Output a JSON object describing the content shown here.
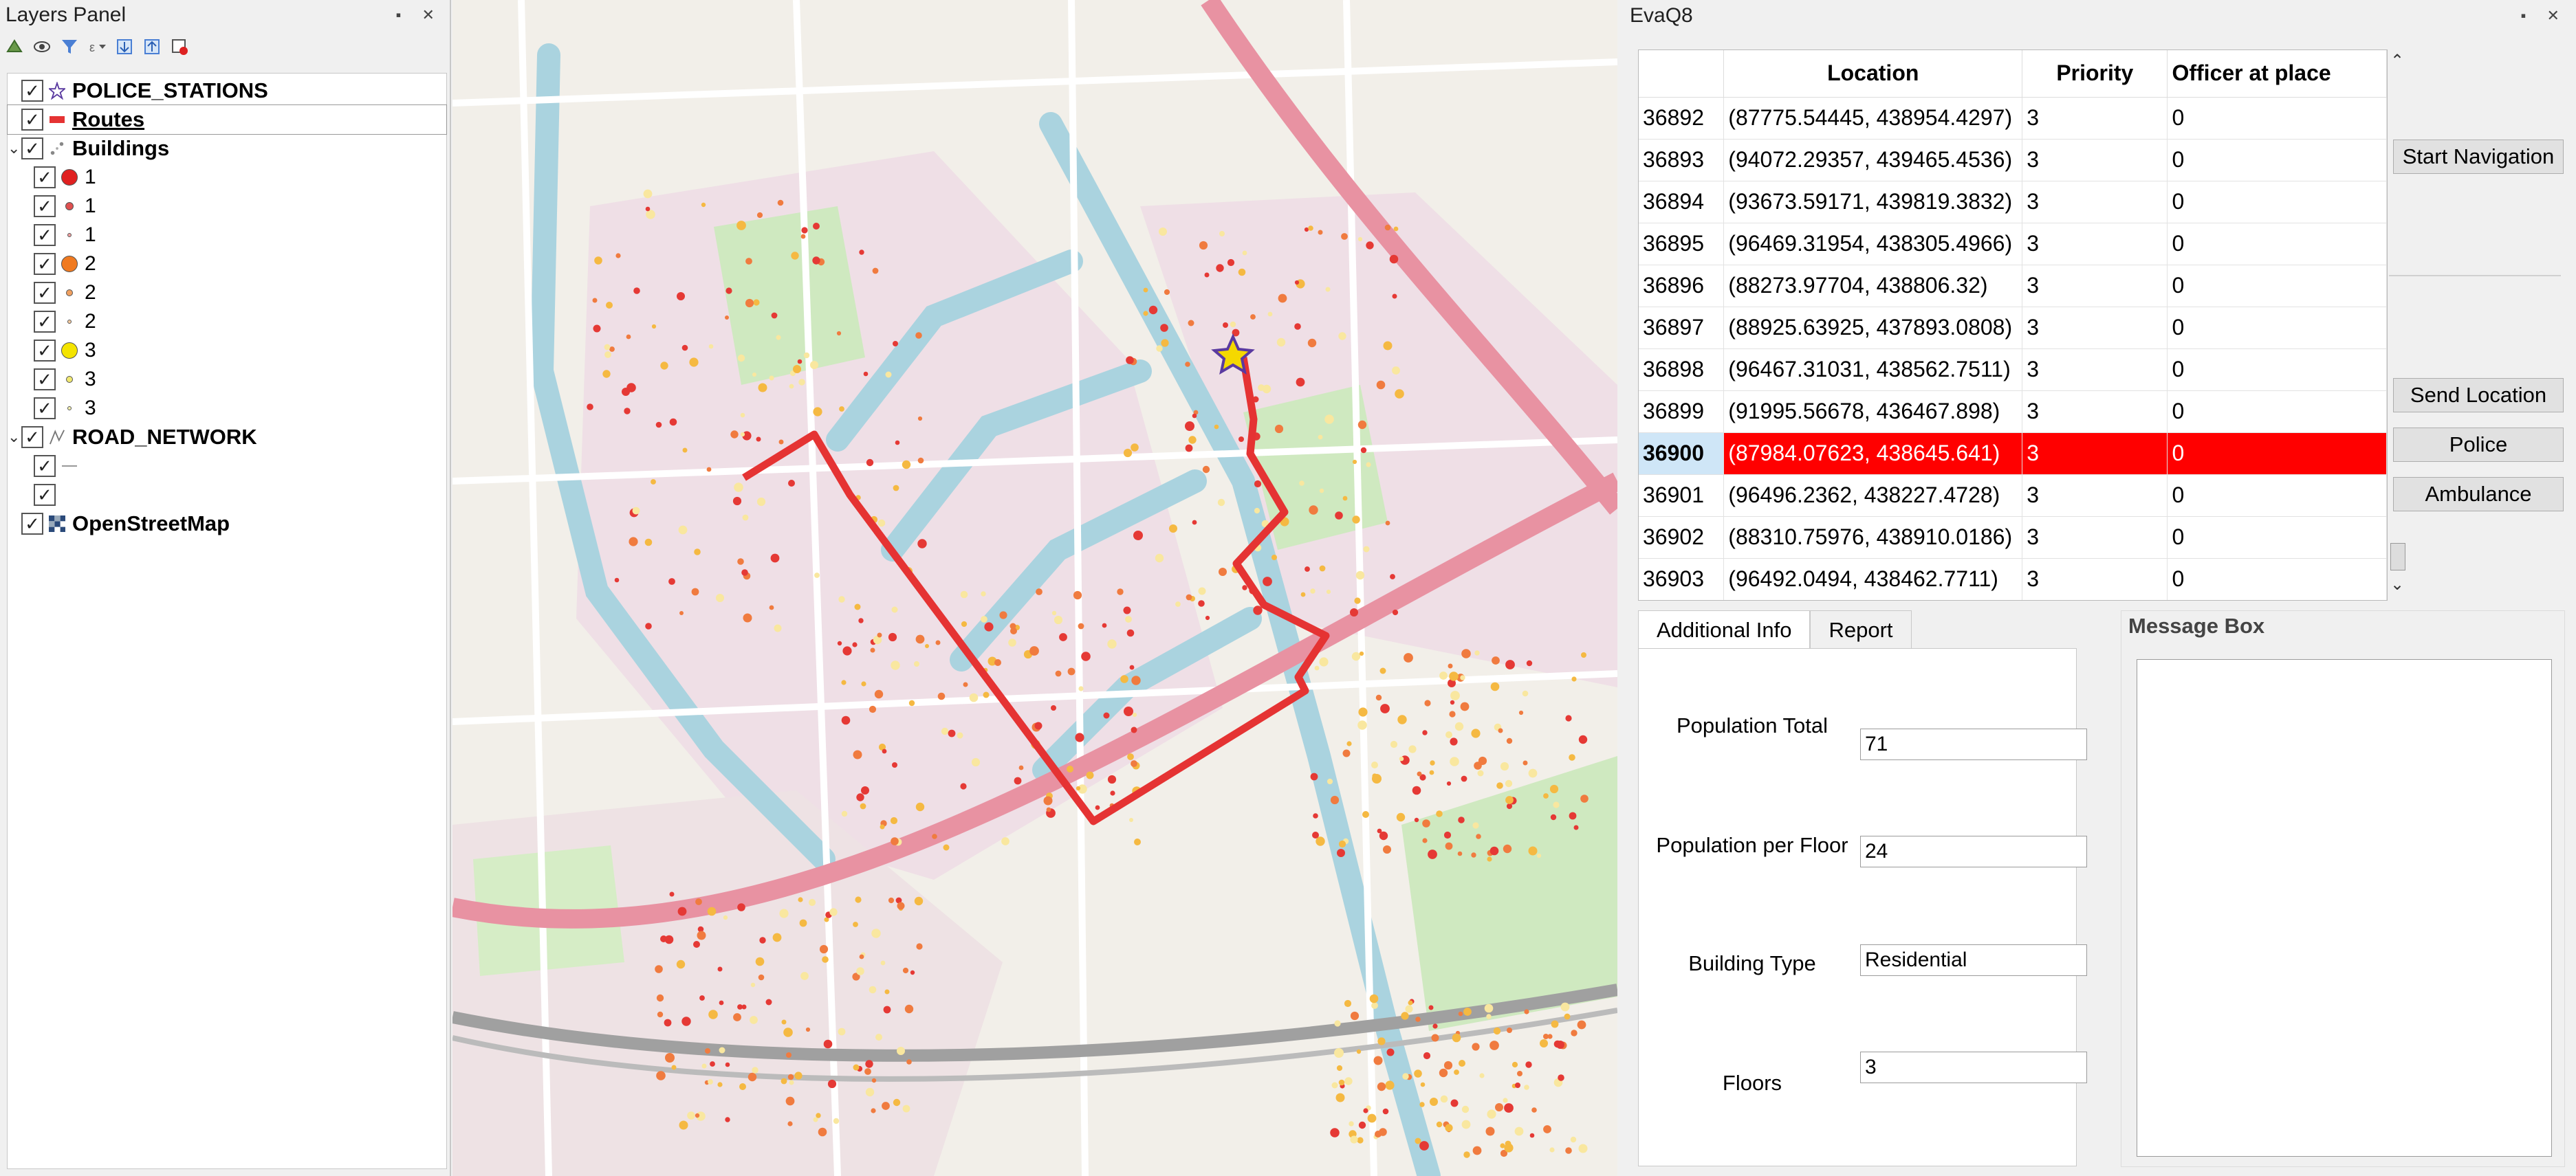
{
  "layers_panel": {
    "title": "Layers Panel",
    "layers": [
      {
        "label": "POLICE_STATIONS",
        "checked": true,
        "icon": "star-icon"
      },
      {
        "label": "Routes",
        "checked": true,
        "icon": "line-red-icon"
      },
      {
        "label": "Buildings",
        "checked": true,
        "icon": "points-icon"
      },
      {
        "label": "ROAD_NETWORK",
        "checked": true,
        "icon": "lines-icon"
      },
      {
        "label": "OpenStreetMap",
        "checked": true,
        "icon": "raster-icon"
      }
    ],
    "buildings_classes": [
      {
        "label": "1",
        "color": "#e02020"
      },
      {
        "label": "1",
        "color": "#e05050"
      },
      {
        "label": "1",
        "color": "#f0a0a0"
      },
      {
        "label": "2",
        "color": "#f07a20"
      },
      {
        "label": "2",
        "color": "#f0a060"
      },
      {
        "label": "2",
        "color": "#f7cca0"
      },
      {
        "label": "3",
        "color": "#f4e400"
      },
      {
        "label": "3",
        "color": "#f0e870"
      },
      {
        "label": "3",
        "color": "#f4f0b0"
      }
    ]
  },
  "map": {
    "route_color": "#e53333",
    "building_colors": [
      "#e53935",
      "#f07b3f",
      "#f5b942",
      "#f9e79f"
    ]
  },
  "evaq8": {
    "title": "EvaQ8",
    "table": {
      "headers": [
        "",
        "Location",
        "Priority",
        "Officer at place"
      ],
      "rows": [
        {
          "id": "36892",
          "location": "(87775.54445, 438954.4297)",
          "priority": "3",
          "officer": "0"
        },
        {
          "id": "36893",
          "location": "(94072.29357, 439465.4536)",
          "priority": "3",
          "officer": "0"
        },
        {
          "id": "36894",
          "location": "(93673.59171, 439819.3832)",
          "priority": "3",
          "officer": "0"
        },
        {
          "id": "36895",
          "location": "(96469.31954, 438305.4966)",
          "priority": "3",
          "officer": "0"
        },
        {
          "id": "36896",
          "location": "(88273.97704, 438806.32)",
          "priority": "3",
          "officer": "0"
        },
        {
          "id": "36897",
          "location": "(88925.63925, 437893.0808)",
          "priority": "3",
          "officer": "0"
        },
        {
          "id": "36898",
          "location": "(96467.31031, 438562.7511)",
          "priority": "3",
          "officer": "0"
        },
        {
          "id": "36899",
          "location": "(91995.56678, 436467.898)",
          "priority": "3",
          "officer": "0"
        },
        {
          "id": "36900",
          "location": "(87984.07623, 438645.641)",
          "priority": "3",
          "officer": "0"
        },
        {
          "id": "36901",
          "location": "(96496.2362, 438227.4728)",
          "priority": "3",
          "officer": "0"
        },
        {
          "id": "36902",
          "location": "(88310.75976, 438910.0186)",
          "priority": "3",
          "officer": "0"
        },
        {
          "id": "36903",
          "location": "(96492.0494, 438462.7711)",
          "priority": "3",
          "officer": "0"
        }
      ],
      "selected_id": "36900"
    },
    "buttons": {
      "start_navigation": "Start Navigation",
      "send_location": "Send Location",
      "police": "Police",
      "ambulance": "Ambulance"
    },
    "tabs": [
      "Additional Info",
      "Report"
    ],
    "active_tab": "Additional Info",
    "info": {
      "population_total_label": "Population Total",
      "population_total": "71",
      "population_per_floor_label": "Population per Floor",
      "population_per_floor": "24",
      "building_type_label": "Building Type",
      "building_type": "Residential",
      "floors_label": "Floors",
      "floors": "3"
    },
    "message_box": {
      "title": "Message Box",
      "text": ""
    }
  }
}
